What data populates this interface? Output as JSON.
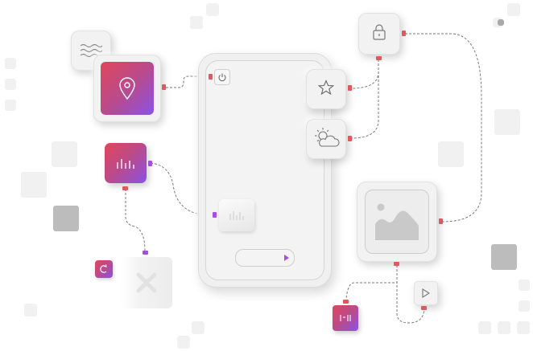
{
  "scene": {
    "phone": {
      "icons": [
        "power-icon",
        "equalizer-icon",
        "play-icon"
      ]
    },
    "nodes": [
      {
        "name": "notes",
        "icon": "wavy-lines-icon"
      },
      {
        "name": "location",
        "icon": "map-pin-icon"
      },
      {
        "name": "audio",
        "icon": "equalizer-icon"
      },
      {
        "name": "lock",
        "icon": "padlock-icon"
      },
      {
        "name": "favorite",
        "icon": "star-icon"
      },
      {
        "name": "weather",
        "icon": "cloud-sun-icon"
      },
      {
        "name": "gallery",
        "icon": "image-icon"
      },
      {
        "name": "video",
        "icon": "play-icon"
      },
      {
        "name": "reload",
        "icon": "refresh-icon"
      },
      {
        "name": "media",
        "icon": "equalizer-icon"
      },
      {
        "name": "disabled",
        "icon": "crossed-out-icon"
      }
    ],
    "colors": {
      "gradient_start": "#e0465a",
      "gradient_end": "#8a52e6",
      "connector": "#e0575e",
      "wire": "#7a7a7a"
    }
  }
}
